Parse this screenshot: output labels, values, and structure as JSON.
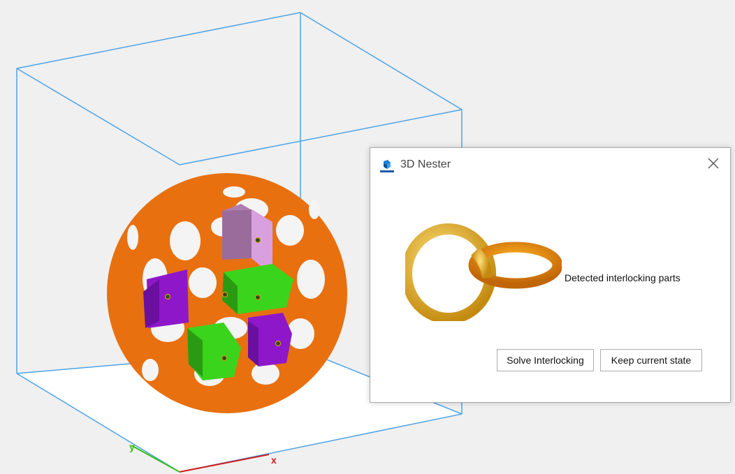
{
  "viewport": {
    "axis_x_label": "x",
    "axis_y_label": "y",
    "colors": {
      "background": "#f0f0f0",
      "floor": "#ffffff",
      "build_box": "#4da3e8",
      "axis_x": "#d11b1b",
      "axis_y": "#36c01a",
      "lattice": "#f07d19",
      "part_purple": "#8e18c9",
      "part_green": "#3bd41c",
      "part_pink": "#d9a0e0"
    }
  },
  "dialog": {
    "title": "3D Nester",
    "app_icon": "3d-nester-logo-icon",
    "close_icon": "close-icon",
    "illustration": "interlocking-rings-icon",
    "message": "Detected interlocking parts",
    "buttons": {
      "solve": "Solve Interlocking",
      "keep": "Keep current state"
    }
  }
}
